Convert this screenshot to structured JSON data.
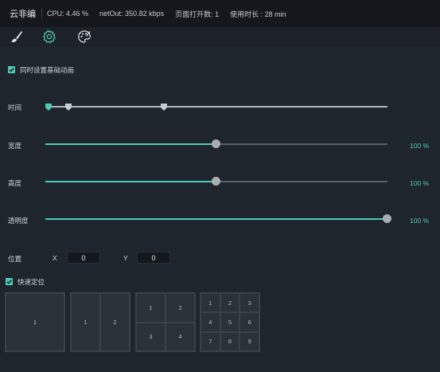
{
  "topbar": {
    "app_title": "云非编",
    "cpu": "CPU: 4.46 %",
    "net_out": "netOut: 350.82 kbps",
    "pages_open": "页面打开数: 1",
    "usage_time": "使用时长 : 28 min"
  },
  "toolbar": {
    "tools": [
      {
        "icon": "brush-icon"
      },
      {
        "icon": "gear-icon",
        "active": true
      },
      {
        "icon": "palette-icon"
      }
    ]
  },
  "sync_animation": {
    "label": "同时设置基础动画",
    "checked": true
  },
  "timeline": {
    "label": "时间",
    "keyframes": 3
  },
  "width": {
    "label": "宽度",
    "value": "100 %",
    "level": 0.5
  },
  "height": {
    "label": "高度",
    "value": "100 %",
    "level": 0.5
  },
  "opacity": {
    "label": "透明度",
    "value": "100 %",
    "level": 1.0
  },
  "position": {
    "label": "位置",
    "x_label": "X",
    "x_value": "0",
    "y_label": "Y",
    "y_value": "0"
  },
  "quick_position": {
    "label": "快速定位",
    "checked": true
  },
  "layouts": [
    {
      "cells": [
        "1"
      ]
    },
    {
      "cells": [
        "1",
        "2"
      ]
    },
    {
      "cells": [
        "1",
        "2",
        "3",
        "4"
      ]
    },
    {
      "cells": [
        "1",
        "2",
        "3",
        "4",
        "5",
        "6",
        "7",
        "8",
        "9"
      ]
    }
  ],
  "colors": {
    "accent": "#4ec9b8",
    "background": "#1f252c",
    "topbar": "#14181d"
  }
}
